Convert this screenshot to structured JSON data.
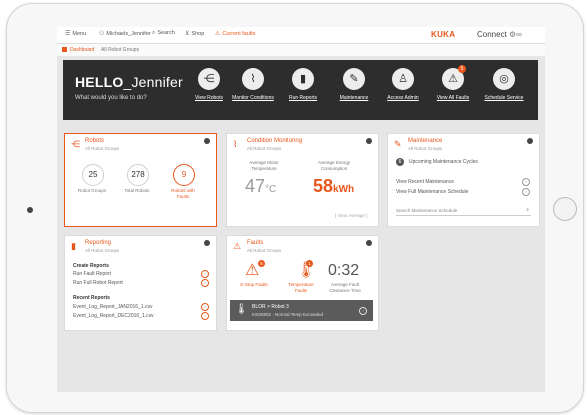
{
  "topbar": {
    "menu_label": "Menu",
    "user_label": "Michaels_Jennifer",
    "search_label": "Search",
    "shop_label": "Shop",
    "faults_label": "Current faults",
    "brand": "KUKA",
    "product": "Connect"
  },
  "breadcrumb": {
    "item1": "Dashboard",
    "item2": "All Robot Groups"
  },
  "hero": {
    "greeting_prefix": "HELLO",
    "user_name": "_Jennifer",
    "subtitle": "What would you like to do?",
    "actions": [
      {
        "label": "View Robots",
        "icon": "share-nodes-icon"
      },
      {
        "label": "Monitor Conditions",
        "icon": "chart-icon"
      },
      {
        "label": "Run Reports",
        "icon": "bar-chart-icon"
      },
      {
        "label": "Maintenance",
        "icon": "wrench-icon"
      },
      {
        "label": "Access Admin",
        "icon": "person-icon"
      },
      {
        "label": "View All Faults",
        "icon": "warning-icon",
        "badge": "5"
      },
      {
        "label": "Schedule Service",
        "icon": "lifebuoy-icon"
      }
    ]
  },
  "robots": {
    "title": "Robots",
    "subtitle": "All Robot Groups",
    "stats": [
      {
        "value": "25",
        "label": "Robot Groups"
      },
      {
        "value": "278",
        "label": "Total Robots"
      },
      {
        "value": "9",
        "label": "Robots with Faults"
      }
    ]
  },
  "condition": {
    "title": "Condition Monitoring",
    "subtitle": "All Robot Groups",
    "temp_label": "Average Motor Temperature",
    "temp_value": "47",
    "temp_unit": "°C",
    "energy_label": "Average Energy Consumption",
    "energy_value": "58",
    "energy_unit": "kWh",
    "view_average": "[ View Average ]"
  },
  "maintenance": {
    "title": "Maintenance",
    "subtitle": "All Robot Groups",
    "upcoming_count": "6",
    "upcoming_label": "Upcoming Maintenance Cycles",
    "links": [
      "View Recent Maintenance",
      "View Full Maintenance Schedule"
    ],
    "search_placeholder": "Search Maintenance Schedule"
  },
  "reporting": {
    "title": "Reporting",
    "subtitle": "All Robot Groups",
    "create_heading": "Create Reports",
    "create_items": [
      "Run Fault Report",
      "Run Full Robot Report"
    ],
    "recent_heading": "Recent Reports",
    "recent_items": [
      "Event_Log_Report_JAN2016_1.csv",
      "Event_Log_Report_DEC2016_1.csv"
    ]
  },
  "faults": {
    "title": "Faults",
    "subtitle": "All Robot Groups",
    "estop_count": "5",
    "estop_label": "E-Stop Faults",
    "temp_count": "1",
    "temp_label": "Temperature Faults",
    "clearance_time": "0:32",
    "clearance_label": "Average Fault Clearance Time",
    "alert_line1": "BLOR > Robot 3",
    "alert_line2": "KSS8902 · Normal Temp Exceeded"
  },
  "colors": {
    "accent": "#e8571c",
    "hero_bg": "#2d2d2d"
  }
}
